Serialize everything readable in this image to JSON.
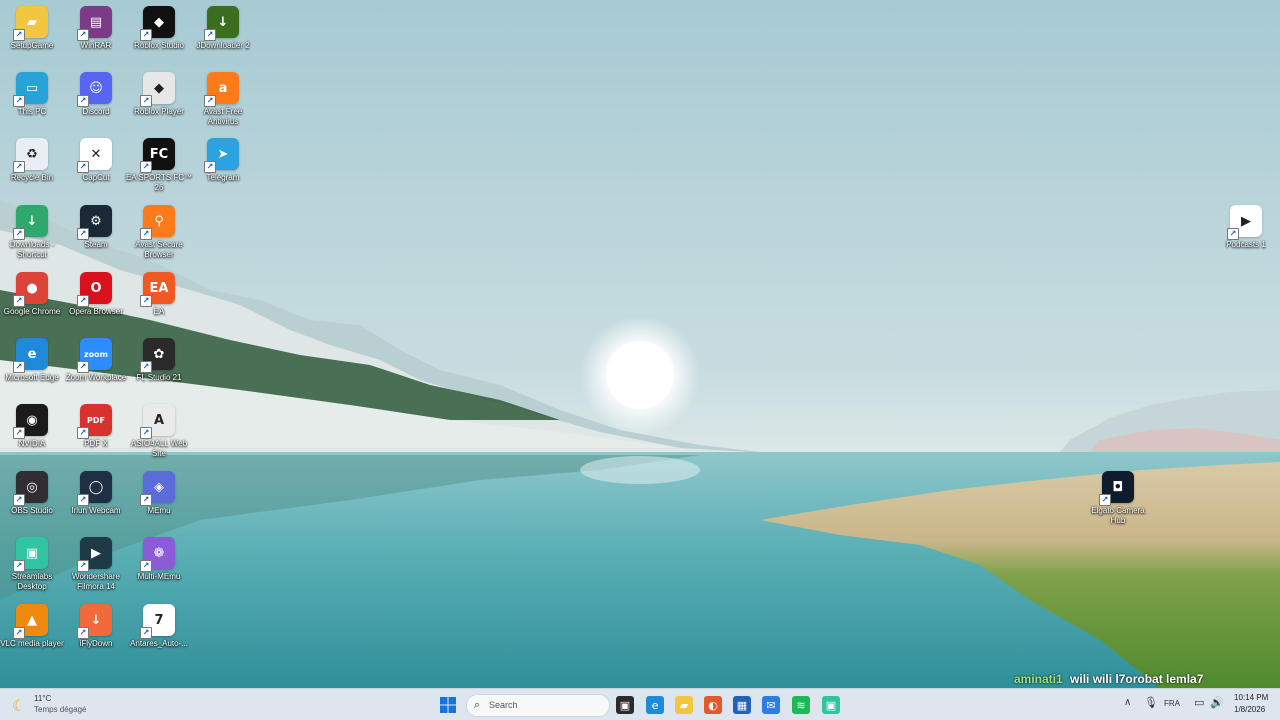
{
  "desktop": {
    "icons": [
      {
        "label": "SetupGame",
        "icon": "folder-user-icon",
        "bg": "#f3c63f",
        "glyph": "▰"
      },
      {
        "label": "This PC",
        "icon": "computer-icon",
        "bg": "#27a3d8",
        "glyph": "▭"
      },
      {
        "label": "Recycle Bin",
        "icon": "recycle-bin-icon",
        "bg": "#e8eef3",
        "glyph": "♻"
      },
      {
        "label": "Downloads - Shortcut",
        "icon": "downloads-folder-icon",
        "bg": "#2fa86d",
        "glyph": "↓"
      },
      {
        "label": "Google Chrome",
        "icon": "chrome-icon",
        "bg": "#db4437",
        "glyph": "●"
      },
      {
        "label": "Microsoft Edge",
        "icon": "edge-icon",
        "bg": "#1f8ad9",
        "glyph": "e"
      },
      {
        "label": "NVIDIA",
        "icon": "nvidia-icon",
        "bg": "#1b1b1b",
        "glyph": "◉"
      },
      {
        "label": "OBS Studio",
        "icon": "obs-icon",
        "bg": "#302e31",
        "glyph": "◎"
      },
      {
        "label": "Streamlabs Desktop",
        "icon": "streamlabs-icon",
        "bg": "#31c3a2",
        "glyph": "▣"
      },
      {
        "label": "VLC media player",
        "icon": "vlc-icon",
        "bg": "#f08a0f",
        "glyph": "▲"
      },
      {
        "label": "WinRAR",
        "icon": "winrar-icon",
        "bg": "#7c3b86",
        "glyph": "▤"
      },
      {
        "label": "Discord",
        "icon": "discord-icon",
        "bg": "#5865f2",
        "glyph": "☺"
      },
      {
        "label": "CapCut",
        "icon": "capcut-icon",
        "bg": "#ffffff",
        "glyph": "✕"
      },
      {
        "label": "Steam",
        "icon": "steam-icon",
        "bg": "#1b2838",
        "glyph": "⚙"
      },
      {
        "label": "Opera Browser",
        "icon": "opera-icon",
        "bg": "#d8121c",
        "glyph": "O"
      },
      {
        "label": "Zoom Workplace",
        "icon": "zoom-icon",
        "bg": "#2d8cff",
        "glyph": "zoom"
      },
      {
        "label": "PDF X",
        "icon": "pdf-icon",
        "bg": "#d8322f",
        "glyph": "PDF"
      },
      {
        "label": "Iriun Webcam",
        "icon": "webcam-icon",
        "bg": "#203044",
        "glyph": "◯"
      },
      {
        "label": "Wondershare Filmora 14",
        "icon": "filmora-icon",
        "bg": "#1e3a47",
        "glyph": "▶"
      },
      {
        "label": "iFlyDown",
        "icon": "iflydown-icon",
        "bg": "#f06a3b",
        "glyph": "↓"
      },
      {
        "label": "Roblox Studio",
        "icon": "roblox-studio-icon",
        "bg": "#111111",
        "glyph": "◆"
      },
      {
        "label": "Roblox Player",
        "icon": "roblox-player-icon",
        "bg": "#e7e7e7",
        "glyph": "◆"
      },
      {
        "label": "EA SPORTS FC™ 26",
        "icon": "fc26-icon",
        "bg": "#111111",
        "glyph": "FC"
      },
      {
        "label": "Avast Secure Browser",
        "icon": "avast-browser-icon",
        "bg": "#ff7b1a",
        "glyph": "⚲"
      },
      {
        "label": "EA",
        "icon": "ea-icon",
        "bg": "#f05a22",
        "glyph": "EA"
      },
      {
        "label": "FL Studio 21",
        "icon": "fl-studio-icon",
        "bg": "#2a2a2a",
        "glyph": "✿"
      },
      {
        "label": "ASIO4ALL Web Site",
        "icon": "asio-icon",
        "bg": "#eaeaea",
        "glyph": "A"
      },
      {
        "label": "MEmu",
        "icon": "memu-icon",
        "bg": "#5b6bd8",
        "glyph": "◈"
      },
      {
        "label": "Multi-MEmu",
        "icon": "multi-memu-icon",
        "bg": "#8b5bd8",
        "glyph": "❁"
      },
      {
        "label": "Antares_Auto-...",
        "icon": "antares-icon",
        "bg": "#ffffff",
        "glyph": "7"
      },
      {
        "label": "JDownloader 2",
        "icon": "jdownloader-icon",
        "bg": "#3b6e1f",
        "glyph": "↓"
      },
      {
        "label": "Avast Free Antivirus",
        "icon": "avast-antivirus-icon",
        "bg": "#ff7b1a",
        "glyph": "a"
      },
      {
        "label": "Telegram",
        "icon": "telegram-icon",
        "bg": "#2aa3e0",
        "glyph": "➤"
      },
      {
        "label": "Podcasts 1",
        "icon": "podcasts-icon",
        "bg": "#ffffff",
        "glyph": "▶"
      },
      {
        "label": "Elgato Camera Hub",
        "icon": "elgato-camera-icon",
        "bg": "#0f1c2e",
        "glyph": "◘"
      }
    ]
  },
  "overlay": {
    "user": "aminati1",
    "message": "wili wili l7orobat lemla7",
    "user_color": "#9be37a",
    "message_color": "#ffffff"
  },
  "taskbar": {
    "weather_temp": "11°C",
    "weather_desc": "Temps dégagé",
    "search_placeholder": "Search",
    "apps": [
      {
        "name": "start-icon",
        "bg": "#1a73d9",
        "glyph": "⊞"
      },
      {
        "name": "task-view-icon",
        "bg": "#2b2b2b",
        "glyph": "▣"
      },
      {
        "name": "edge-taskbar-icon",
        "bg": "#1f8ad9",
        "glyph": "e"
      },
      {
        "name": "file-explorer-icon",
        "bg": "#f3c63f",
        "glyph": "▰"
      },
      {
        "name": "firefox-icon",
        "bg": "#e8562a",
        "glyph": "◐"
      },
      {
        "name": "store-icon",
        "bg": "#2560b8",
        "glyph": "▦"
      },
      {
        "name": "outlook-icon",
        "bg": "#2e7de3",
        "glyph": "✉"
      },
      {
        "name": "spotify-icon",
        "bg": "#1db954",
        "glyph": "≋"
      },
      {
        "name": "streamlabs-taskbar-icon",
        "bg": "#31c3a2",
        "glyph": "▣"
      }
    ],
    "language": "FRA",
    "time": "10:14 PM",
    "date": "1/8/2026"
  }
}
